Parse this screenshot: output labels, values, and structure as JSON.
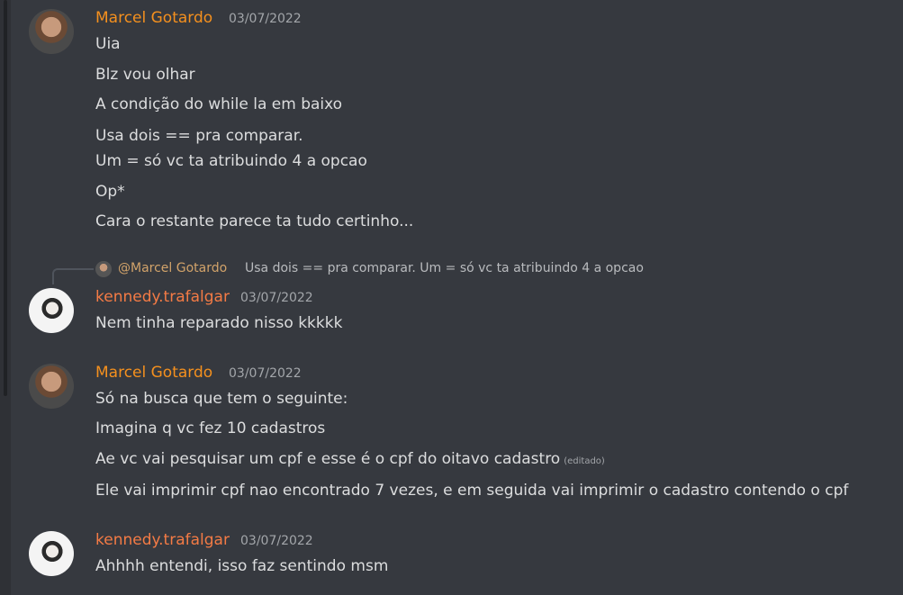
{
  "groups": [
    {
      "author": "Marcel Gotardo",
      "timestamp": "03/07/2022",
      "lines": [
        "Uia",
        "Blz vou olhar",
        "A condição do while la em baixo",
        "Usa dois == pra comparar.",
        "Um = só vc ta atribuindo 4 a opcao",
        "Op*",
        "Cara o restante parece ta tudo certinho..."
      ]
    },
    {
      "reply": {
        "mention": "@Marcel Gotardo",
        "text": "Usa dois == pra comparar. Um = só vc ta atribuindo 4 a opcao"
      },
      "author": "kennedy.trafalgar",
      "timestamp": "03/07/2022",
      "lines": [
        "Nem tinha reparado nisso kkkkk"
      ]
    },
    {
      "author": "Marcel Gotardo",
      "timestamp": "03/07/2022",
      "lines": [
        "Só na busca que tem o seguinte:",
        "Imagina q vc fez 10 cadastros",
        "Ae  vc vai pesquisar um cpf e esse é o cpf do oitavo cadastro",
        "Ele vai imprimir cpf nao encontrado 7 vezes, e em seguida vai imprimir o cadastro contendo o cpf"
      ],
      "edited_label": "(editado)"
    },
    {
      "author": "kennedy.trafalgar",
      "timestamp": "03/07/2022",
      "lines": [
        "Ahhhh entendi, isso faz sentindo msm"
      ]
    }
  ],
  "colors": {
    "background": "#36393f",
    "marcel_name": "#f4901e",
    "kennedy_name": "#f47b45",
    "text": "#dcddde",
    "muted": "#a3a6aa"
  },
  "icons": [
    "avatar-marcel",
    "avatar-kennedy",
    "reply-avatar"
  ]
}
